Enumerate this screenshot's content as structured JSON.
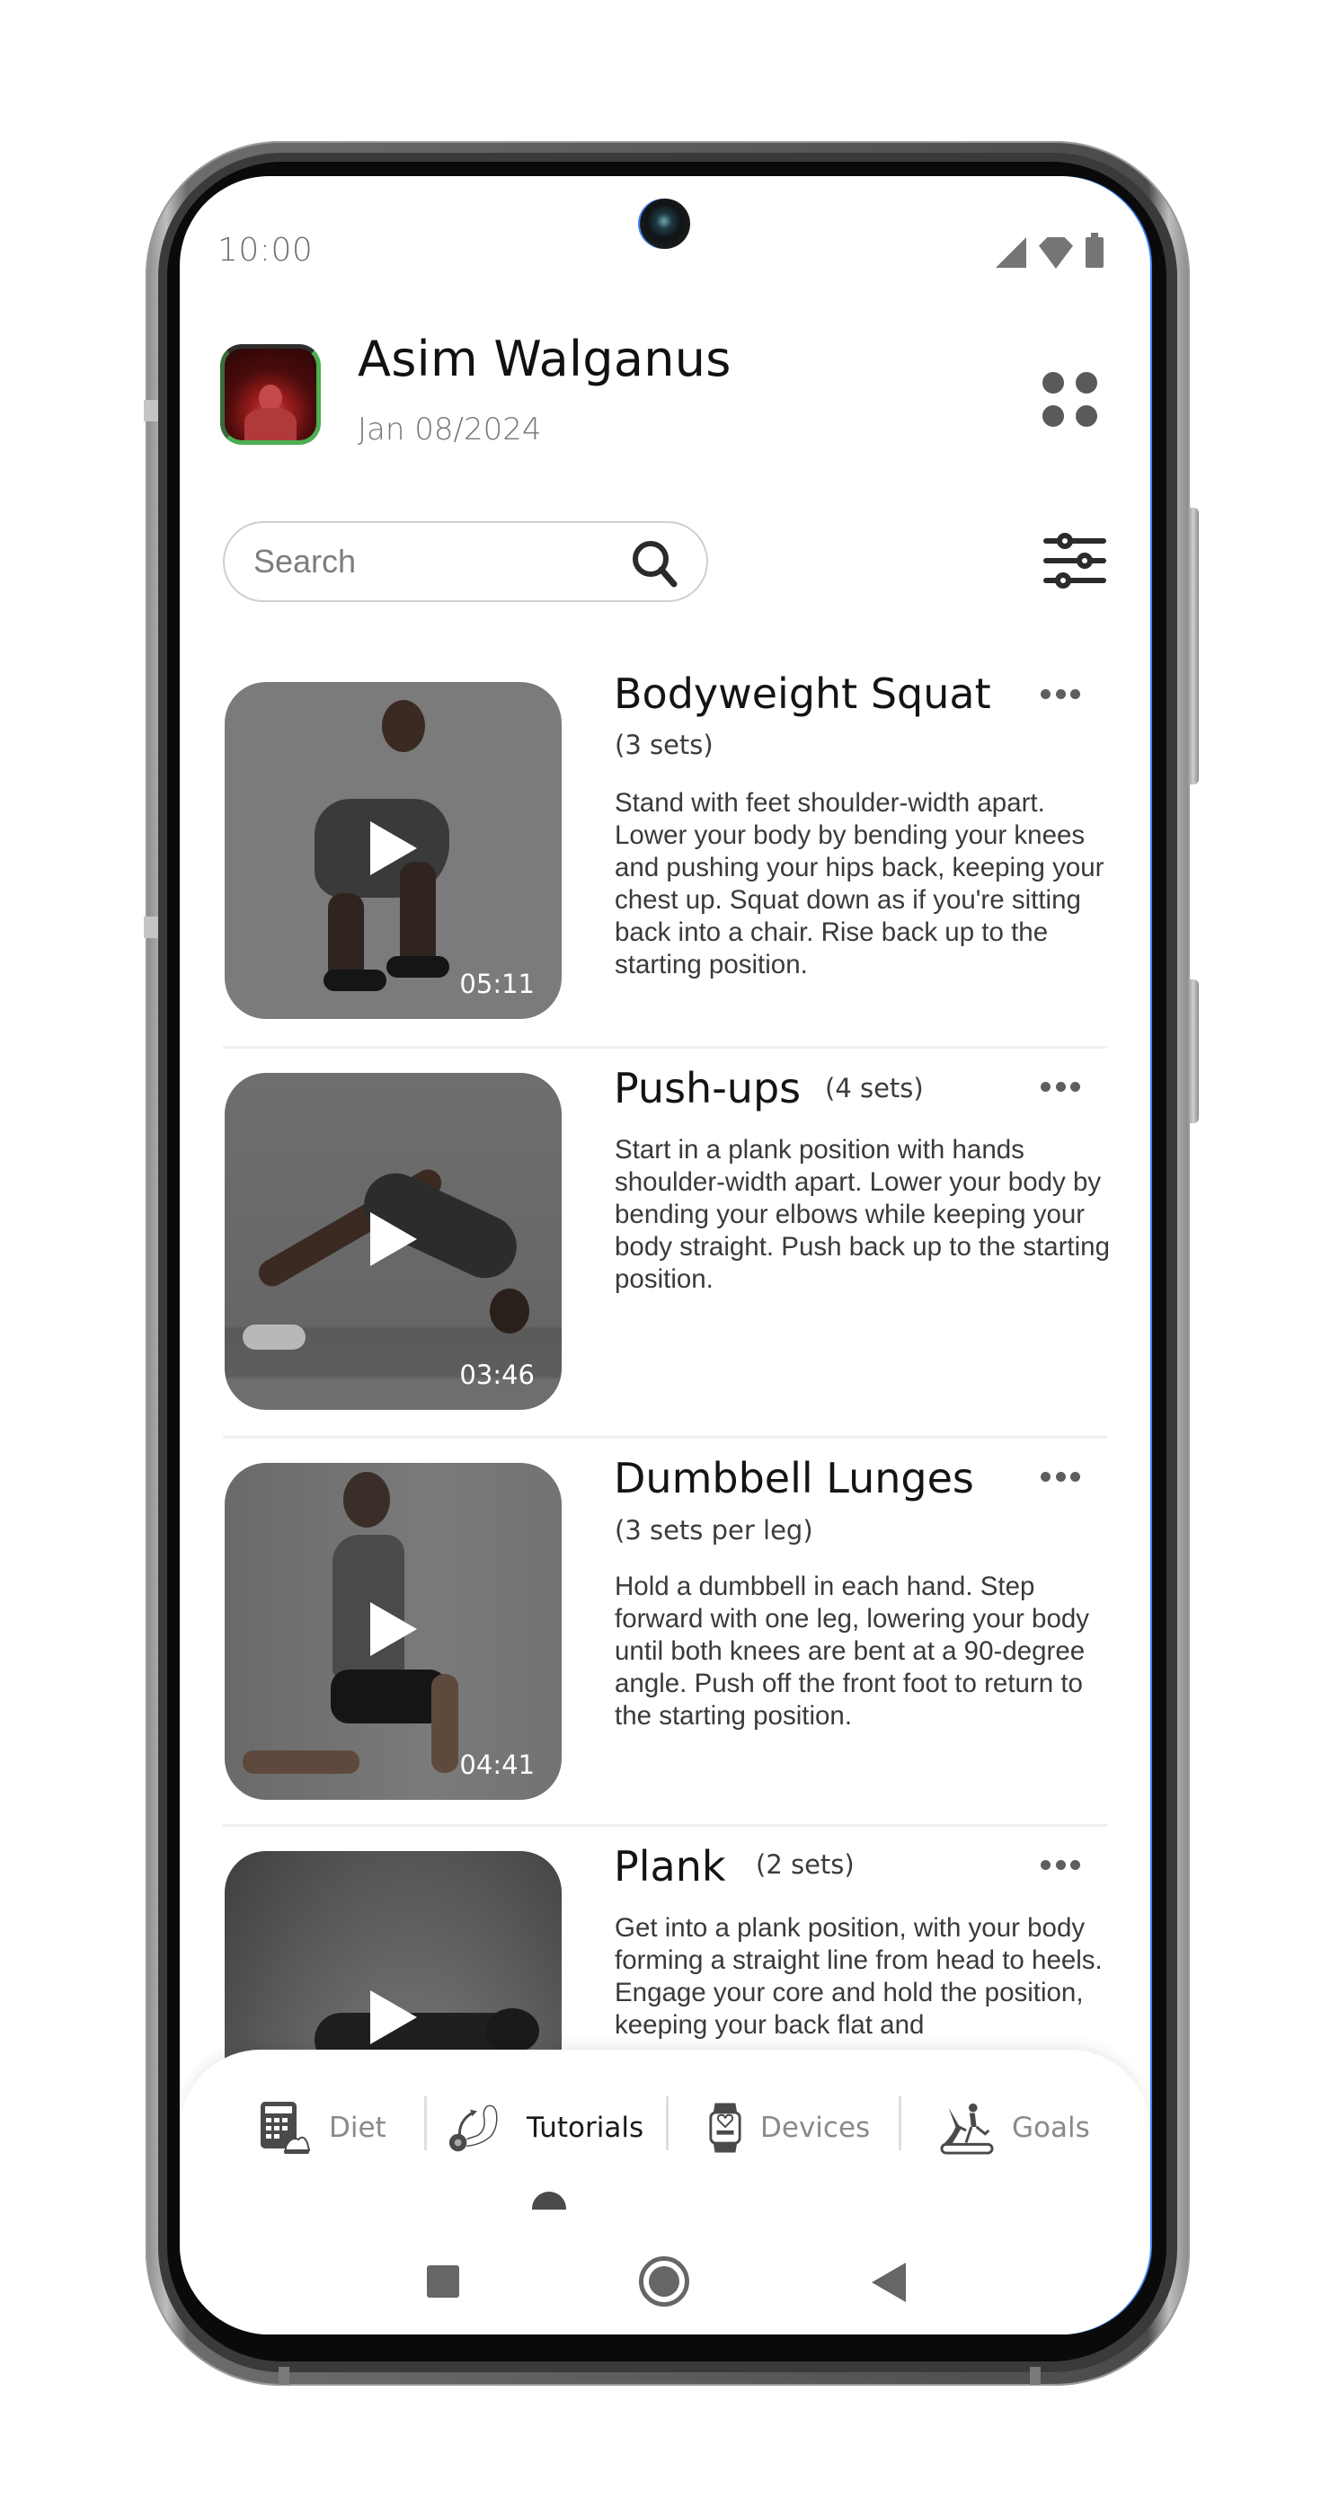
{
  "status_bar": {
    "time": "10:00",
    "icons": [
      "signal-icon",
      "wifi-icon",
      "battery-icon"
    ]
  },
  "header": {
    "user_name": "Asim Walganus",
    "date": "Jan 08/2024",
    "avatar_ring_color": "#4caf50",
    "menu_icon": "grid-dots-icon"
  },
  "search": {
    "placeholder": "Search",
    "value": "",
    "icon": "search-icon",
    "filter_icon": "filter-sliders-icon"
  },
  "exercises": [
    {
      "title": "Bodyweight Squat",
      "sets": "(3 sets)",
      "duration": "05:11",
      "description": "Stand with feet shoulder-width apart. Lower your body by bending your knees and pushing your hips back, keeping your chest up. Squat down as if you're sitting back into a chair. Rise back up to the starting position."
    },
    {
      "title": "Push-ups",
      "sets": "(4 sets)",
      "duration": "03:46",
      "description": "Start in a plank position with hands shoulder-width apart. Lower your body by bending your elbows while keeping your body straight. Push back up to the starting position."
    },
    {
      "title": "Dumbbell Lunges",
      "sets": "(3 sets per leg)",
      "duration": "04:41",
      "description": "Hold a dumbbell in each hand. Step forward with one leg, lowering your body until both knees are bent at a 90-degree angle. Push off the front foot to return to the starting position."
    },
    {
      "title": "Plank",
      "sets": "(2 sets)",
      "duration": "",
      "description": "Get into a plank position, with your body forming a straight line from head to heels. Engage your core and hold the position, keeping your back flat and"
    }
  ],
  "bottom_nav": {
    "active": "Tutorials",
    "items": [
      {
        "label": "Diet",
        "icon": "calculator-food-icon"
      },
      {
        "label": "Tutorials",
        "icon": "arm-dumbbell-icon"
      },
      {
        "label": "Devices",
        "icon": "smartwatch-icon"
      },
      {
        "label": "Goals",
        "icon": "treadmill-runner-icon"
      }
    ]
  },
  "system_nav": {
    "buttons": [
      "recents-button",
      "home-button",
      "back-button"
    ]
  },
  "colors": {
    "accent_green": "#4caf50",
    "text_primary": "#141414",
    "text_secondary": "#777777",
    "icon_gray": "#5e5e5e"
  }
}
